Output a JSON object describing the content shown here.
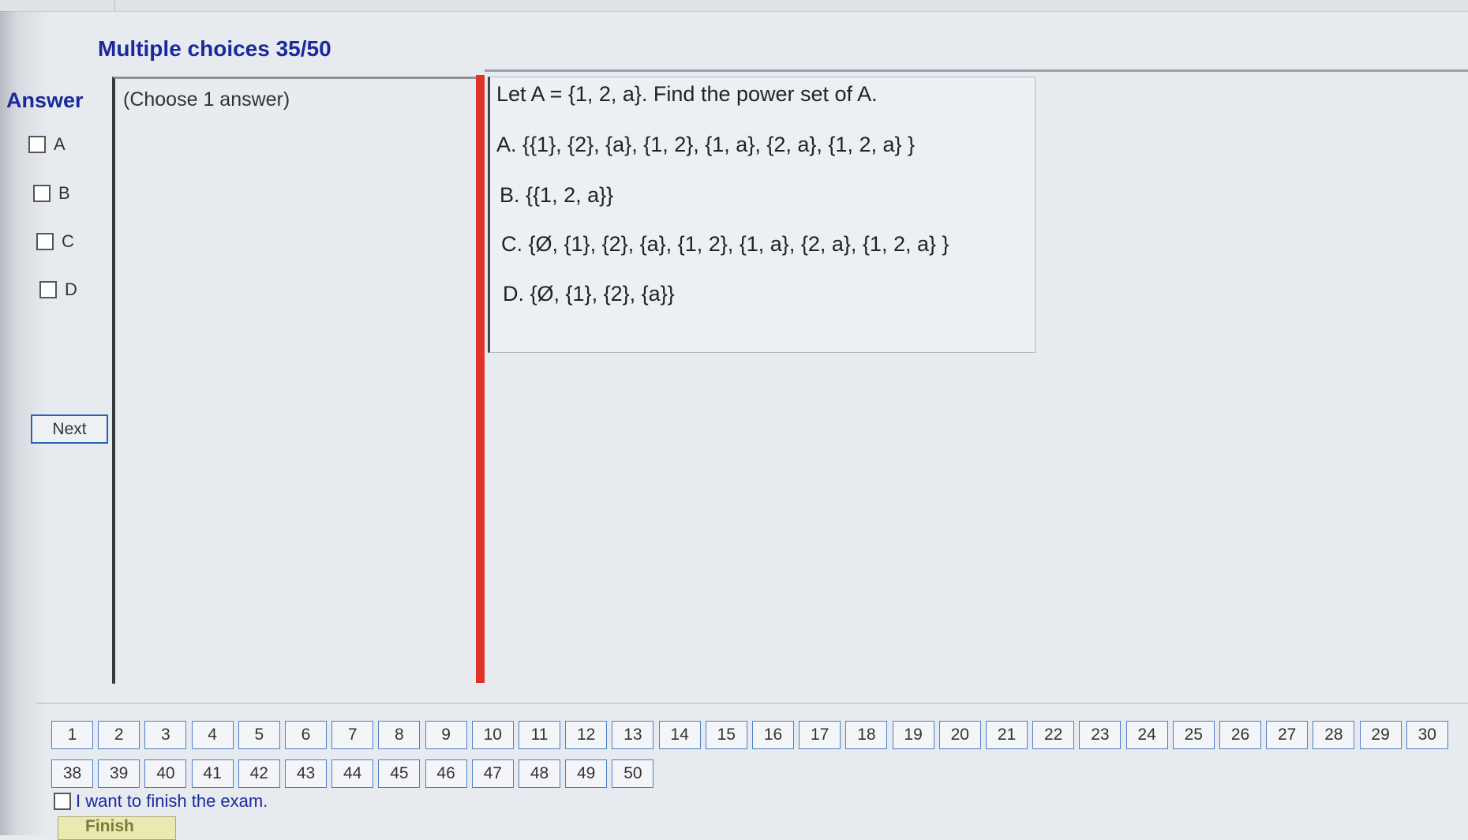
{
  "header": {
    "title": "Multiple choices 35/50"
  },
  "answer": {
    "label": "Answer",
    "options": [
      {
        "letter": "A",
        "checked": false
      },
      {
        "letter": "B",
        "checked": false
      },
      {
        "letter": "C",
        "checked": false
      },
      {
        "letter": "D",
        "checked": false
      }
    ],
    "next_label": "Next"
  },
  "instruction": "(Choose 1 answer)",
  "question": {
    "prompt": "Let A = {1, 2, a}. Find the power set of A.",
    "choices": [
      "A.  {{1}, {2}, {a}, {1, 2}, {1, a}, {2, a}, {1, 2, a} }",
      "B.  {{1, 2, a}}",
      "C.  {Ø, {1}, {2}, {a}, {1, 2}, {1, a}, {2, a}, {1, 2, a} }",
      "D.  {Ø, {1}, {2}, {a}}"
    ]
  },
  "navigation": {
    "row1": [
      "1",
      "2",
      "3",
      "4",
      "5",
      "6",
      "7",
      "8",
      "9",
      "10",
      "11",
      "12",
      "13",
      "14",
      "15",
      "16",
      "17",
      "18",
      "19",
      "20",
      "21",
      "22",
      "23",
      "24",
      "25",
      "26",
      "27",
      "28",
      "29",
      "30"
    ],
    "row2": [
      "38",
      "39",
      "40",
      "41",
      "42",
      "43",
      "44",
      "45",
      "46",
      "47",
      "48",
      "49",
      "50"
    ],
    "current": "35"
  },
  "finish": {
    "checkbox_label": "I want to finish the exam.",
    "button_label": "Finish"
  },
  "colors": {
    "accent_blue": "#1a2a9c",
    "border_blue": "#4d7fc9",
    "red_divider": "#e0322a"
  }
}
